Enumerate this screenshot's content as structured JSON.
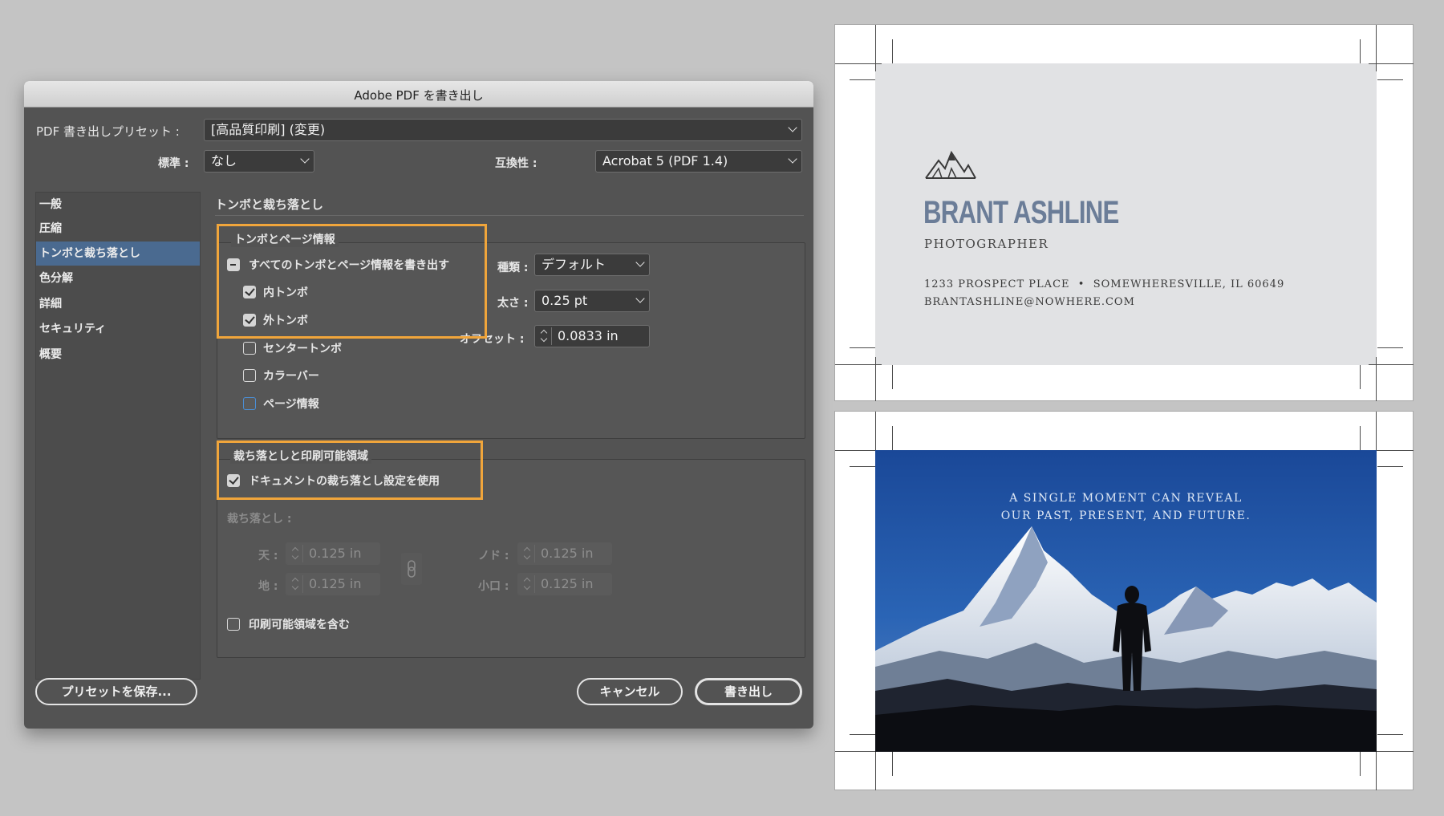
{
  "dialog": {
    "title": "Adobe PDF を書き出し",
    "preset_label": "PDF 書き出しプリセット :",
    "preset_value": "[高品質印刷] (変更)",
    "standard_label": "標準 :",
    "standard_value": "なし",
    "compat_label": "互換性 :",
    "compat_value": "Acrobat 5 (PDF 1.4)",
    "sidebar": [
      "一般",
      "圧縮",
      "トンボと裁ち落とし",
      "色分解",
      "詳細",
      "セキュリティ",
      "概要"
    ],
    "section_title": "トンボと裁ち落とし",
    "marks": {
      "group_title": "トンボとページ情報",
      "all_marks": "すべてのトンボとページ情報を書き出す",
      "crop_marks": "内トンボ",
      "bleed_marks": "外トンボ",
      "registration_marks": "センタートンボ",
      "color_bars": "カラーバー",
      "page_info": "ページ情報",
      "type_label": "種類 :",
      "type_value": "デフォルト",
      "weight_label": "太さ :",
      "weight_value": "0.25 pt",
      "offset_label": "オフセット :",
      "offset_value": "0.0833 in"
    },
    "bleed": {
      "group_title": "裁ち落としと印刷可能領域",
      "use_doc_bleed": "ドキュメントの裁ち落とし設定を使用",
      "bleeds_label": "裁ち落とし :",
      "top_label": "天 :",
      "top_value": "0.125 in",
      "bottom_label": "地 :",
      "bottom_value": "0.125 in",
      "inside_label": "ノド :",
      "inside_value": "0.125 in",
      "outside_label": "小口 :",
      "outside_value": "0.125 in",
      "include_slug": "印刷可能領域を含む"
    },
    "save_preset": "プリセットを保存...",
    "cancel": "キャンセル",
    "export": "書き出し"
  },
  "card_front": {
    "name": "BRANT ASHLINE",
    "title": "PHOTOGRAPHER",
    "address": "1233 PROSPECT PLACE  •  SOMEWHERESVILLE, IL 60649",
    "email": "BRANTASHLINE@NOWHERE.COM"
  },
  "card_back": {
    "quote_line1": "A SINGLE MOMENT CAN REVEAL",
    "quote_line2": "OUR PAST, PRESENT, AND FUTURE."
  },
  "colors": {
    "background": "#c4c4c4",
    "dialog_bg": "#535353",
    "highlight": "#f0a53b",
    "selected_sidebar": "#4a6a90",
    "card_name": "#6b7d98",
    "card_panel": "#e1e2e4",
    "sky": "#1d4f9c"
  }
}
